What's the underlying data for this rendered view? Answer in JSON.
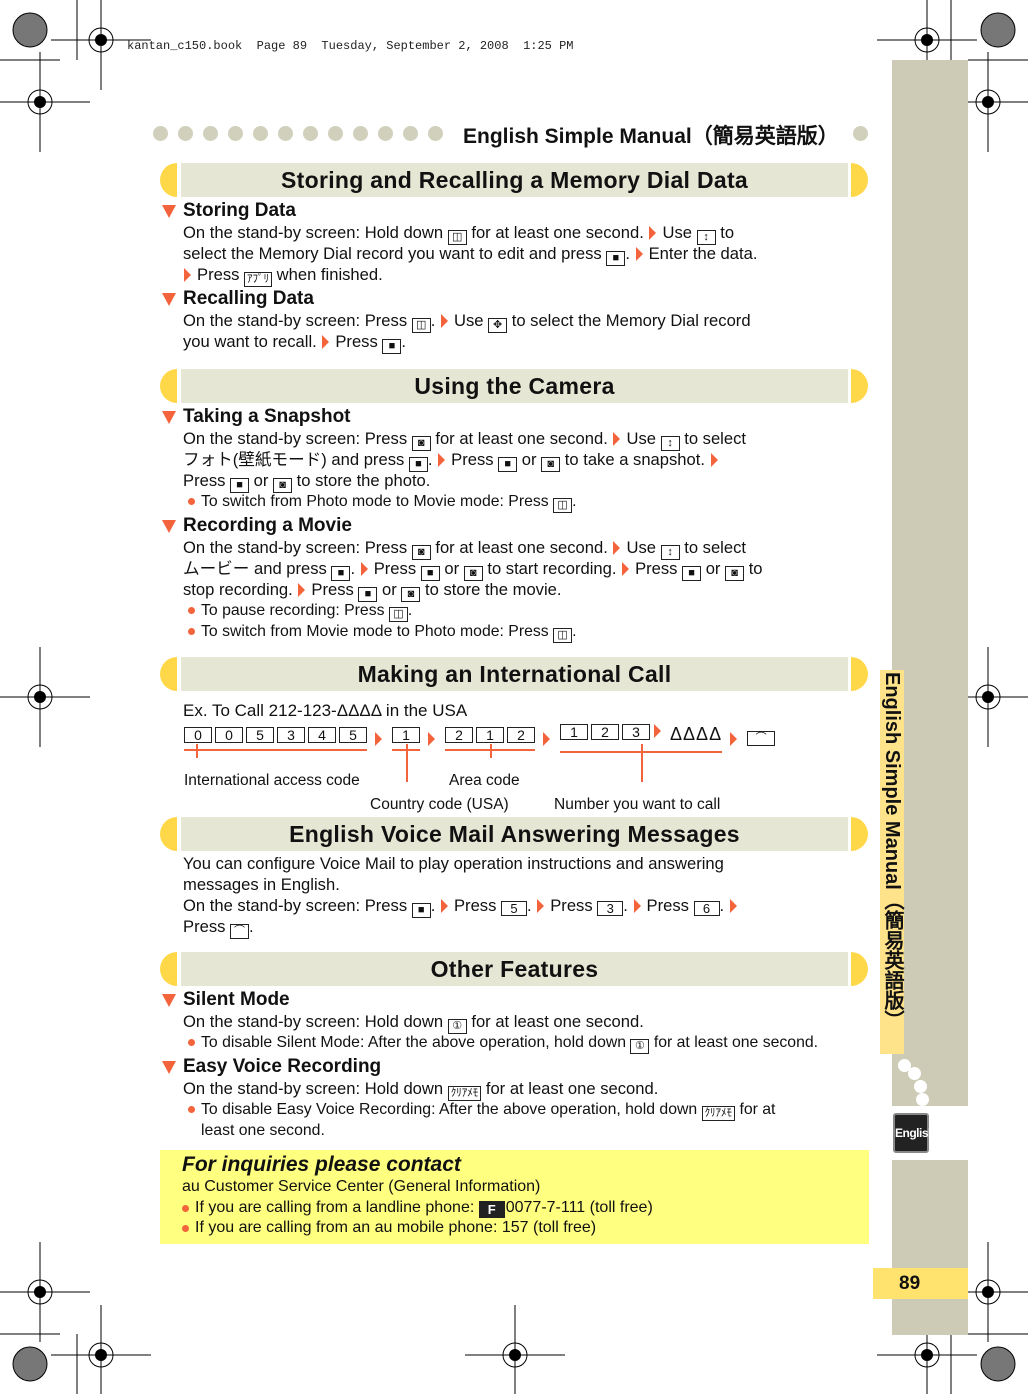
{
  "print_header": "kantan_c150.book  Page 89  Tuesday, September 2, 2008  1:25 PM",
  "header": {
    "title": "English Simple Manual（簡易英語版）"
  },
  "side_tab": {
    "label": "English Simple Manual（簡易英語版）",
    "badge": "English"
  },
  "page_number": "89",
  "colors": {
    "accent": "#f4643c",
    "cap": "#ffd84a",
    "band": "#e6e6d4",
    "sidebar": "#cdcbb5",
    "contact_bg": "#ffff80"
  },
  "key_icons": {
    "mail": "◫",
    "updown": "↕",
    "center": "■",
    "app": "ｱﾌﾟﾘ",
    "nav4": "✥",
    "camera": "◙",
    "phone": "⌒",
    "silent": "①",
    "memo": "ｸﾘｱﾒﾓ"
  },
  "sections": [
    {
      "title": "Storing and Recalling a Memory Dial Data",
      "subs": [
        {
          "heading": "Storing Data",
          "lines": [
            {
              "segs": [
                "On the stand-by screen: Hold down ",
                {
                  "k": "mail"
                },
                " for at least one second. ",
                {
                  "a": 1
                },
                "Use ",
                {
                  "k": "updown"
                },
                " to"
              ]
            },
            {
              "segs": [
                "select the Memory Dial record you want to edit and press ",
                {
                  "k": "center"
                },
                ". ",
                {
                  "a": 1
                },
                "Enter the data."
              ]
            },
            {
              "segs": [
                {
                  "a": 1
                },
                "Press ",
                {
                  "k": "app"
                },
                " when finished."
              ]
            }
          ]
        },
        {
          "heading": "Recalling Data",
          "lines": [
            {
              "segs": [
                "On the stand-by screen: Press ",
                {
                  "k": "mail"
                },
                ". ",
                {
                  "a": 1
                },
                "Use ",
                {
                  "k": "nav4"
                },
                " to select the Memory Dial record"
              ]
            },
            {
              "segs": [
                "you want to recall. ",
                {
                  "a": 1
                },
                "Press ",
                {
                  "k": "center"
                },
                "."
              ]
            }
          ]
        }
      ]
    },
    {
      "title": "Using the Camera",
      "subs": [
        {
          "heading": "Taking a Snapshot",
          "lines": [
            {
              "segs": [
                "On the stand-by screen: Press ",
                {
                  "k": "camera"
                },
                " for at least one second. ",
                {
                  "a": 1
                },
                "Use ",
                {
                  "k": "updown"
                },
                " to select"
              ]
            },
            {
              "segs": [
                "フォト(壁紙モード) and press ",
                {
                  "k": "center"
                },
                ". ",
                {
                  "a": 1
                },
                "Press ",
                {
                  "k": "center"
                },
                " or ",
                {
                  "k": "camera"
                },
                " to take a snapshot. ",
                {
                  "a": 1
                }
              ]
            },
            {
              "segs": [
                "Press ",
                {
                  "k": "center"
                },
                " or ",
                {
                  "k": "camera"
                },
                " to store the photo."
              ]
            },
            {
              "type": "bullet",
              "segs": [
                "To switch from Photo mode to Movie mode: Press ",
                {
                  "k": "mail"
                },
                "."
              ]
            }
          ]
        },
        {
          "heading": "Recording a Movie",
          "lines": [
            {
              "segs": [
                "On the stand-by screen: Press ",
                {
                  "k": "camera"
                },
                " for at least one second. ",
                {
                  "a": 1
                },
                "Use ",
                {
                  "k": "updown"
                },
                " to select"
              ]
            },
            {
              "segs": [
                "ムービー and press ",
                {
                  "k": "center"
                },
                ". ",
                {
                  "a": 1
                },
                "Press ",
                {
                  "k": "center"
                },
                " or ",
                {
                  "k": "camera"
                },
                " to start recording. ",
                {
                  "a": 1
                },
                "Press ",
                {
                  "k": "center"
                },
                " or ",
                {
                  "k": "camera"
                },
                " to"
              ]
            },
            {
              "segs": [
                "stop recording. ",
                {
                  "a": 1
                },
                "Press ",
                {
                  "k": "center"
                },
                " or ",
                {
                  "k": "camera"
                },
                " to store the movie."
              ]
            },
            {
              "type": "bullet",
              "segs": [
                "To pause recording: Press ",
                {
                  "k": "mail"
                },
                "."
              ]
            },
            {
              "type": "bullet",
              "segs": [
                "To switch from Movie mode to Photo mode: Press ",
                {
                  "k": "mail"
                },
                "."
              ]
            }
          ]
        }
      ]
    },
    {
      "title": "Making an International Call",
      "example": "Ex. To Call 212-123-ΔΔΔΔ in the USA",
      "dial_groups": [
        {
          "keys": [
            "0",
            "0",
            "5",
            "3",
            "4",
            "5"
          ],
          "label": "International access code"
        },
        {
          "keys": [
            "1"
          ],
          "label": "Country code (USA)"
        },
        {
          "keys": [
            "2",
            "1",
            "2"
          ],
          "label": "Area code"
        },
        {
          "keys": [
            "1",
            "2",
            "3"
          ],
          "label": "Number you want to call",
          "suffix": "ΔΔΔΔ"
        }
      ],
      "dial_end_key": "phone"
    },
    {
      "title": "English Voice Mail Answering Messages",
      "subs": [
        {
          "lines": [
            {
              "segs": [
                "You can configure Voice Mail to play operation instructions and answering"
              ]
            },
            {
              "segs": [
                "messages in English."
              ]
            },
            {
              "segs": [
                "On the stand-by screen: Press ",
                {
                  "k": "center"
                },
                ". ",
                {
                  "a": 1
                },
                "Press ",
                {
                  "d": "5"
                },
                ". ",
                {
                  "a": 1
                },
                "Press ",
                {
                  "d": "3"
                },
                ". ",
                {
                  "a": 1
                },
                "Press ",
                {
                  "d": "6"
                },
                ". ",
                {
                  "a": 1
                }
              ]
            },
            {
              "segs": [
                "Press ",
                {
                  "k": "phone"
                },
                "."
              ]
            }
          ]
        }
      ]
    },
    {
      "title": "Other Features",
      "subs": [
        {
          "heading": "Silent Mode",
          "lines": [
            {
              "segs": [
                "On the stand-by screen: Hold down ",
                {
                  "k": "silent"
                },
                " for at least one second."
              ]
            },
            {
              "type": "bullet",
              "segs": [
                "To disable Silent Mode: After the above operation, hold down ",
                {
                  "k": "silent"
                },
                " for at least one second."
              ]
            }
          ]
        },
        {
          "heading": "Easy Voice Recording",
          "lines": [
            {
              "segs": [
                "On the stand-by screen: Hold down ",
                {
                  "k": "memo"
                },
                " for at least one second."
              ]
            },
            {
              "type": "bullet",
              "segs": [
                "To disable Easy Voice Recording: After the above operation, hold down ",
                {
                  "k": "memo"
                },
                " for at"
              ]
            },
            {
              "type": "indent",
              "segs": [
                "least one second."
              ]
            }
          ]
        }
      ]
    }
  ],
  "contact": {
    "title": "For inquiries please contact",
    "center": "au Customer Service Center (General Information)",
    "items": [
      {
        "text": "If you are calling from a landline phone: ",
        "freecall_logo": "フリーコール",
        "number": "0077-7-111 (toll free)"
      },
      {
        "text": "If you are calling from an au mobile phone: 157 (toll free)"
      }
    ]
  }
}
